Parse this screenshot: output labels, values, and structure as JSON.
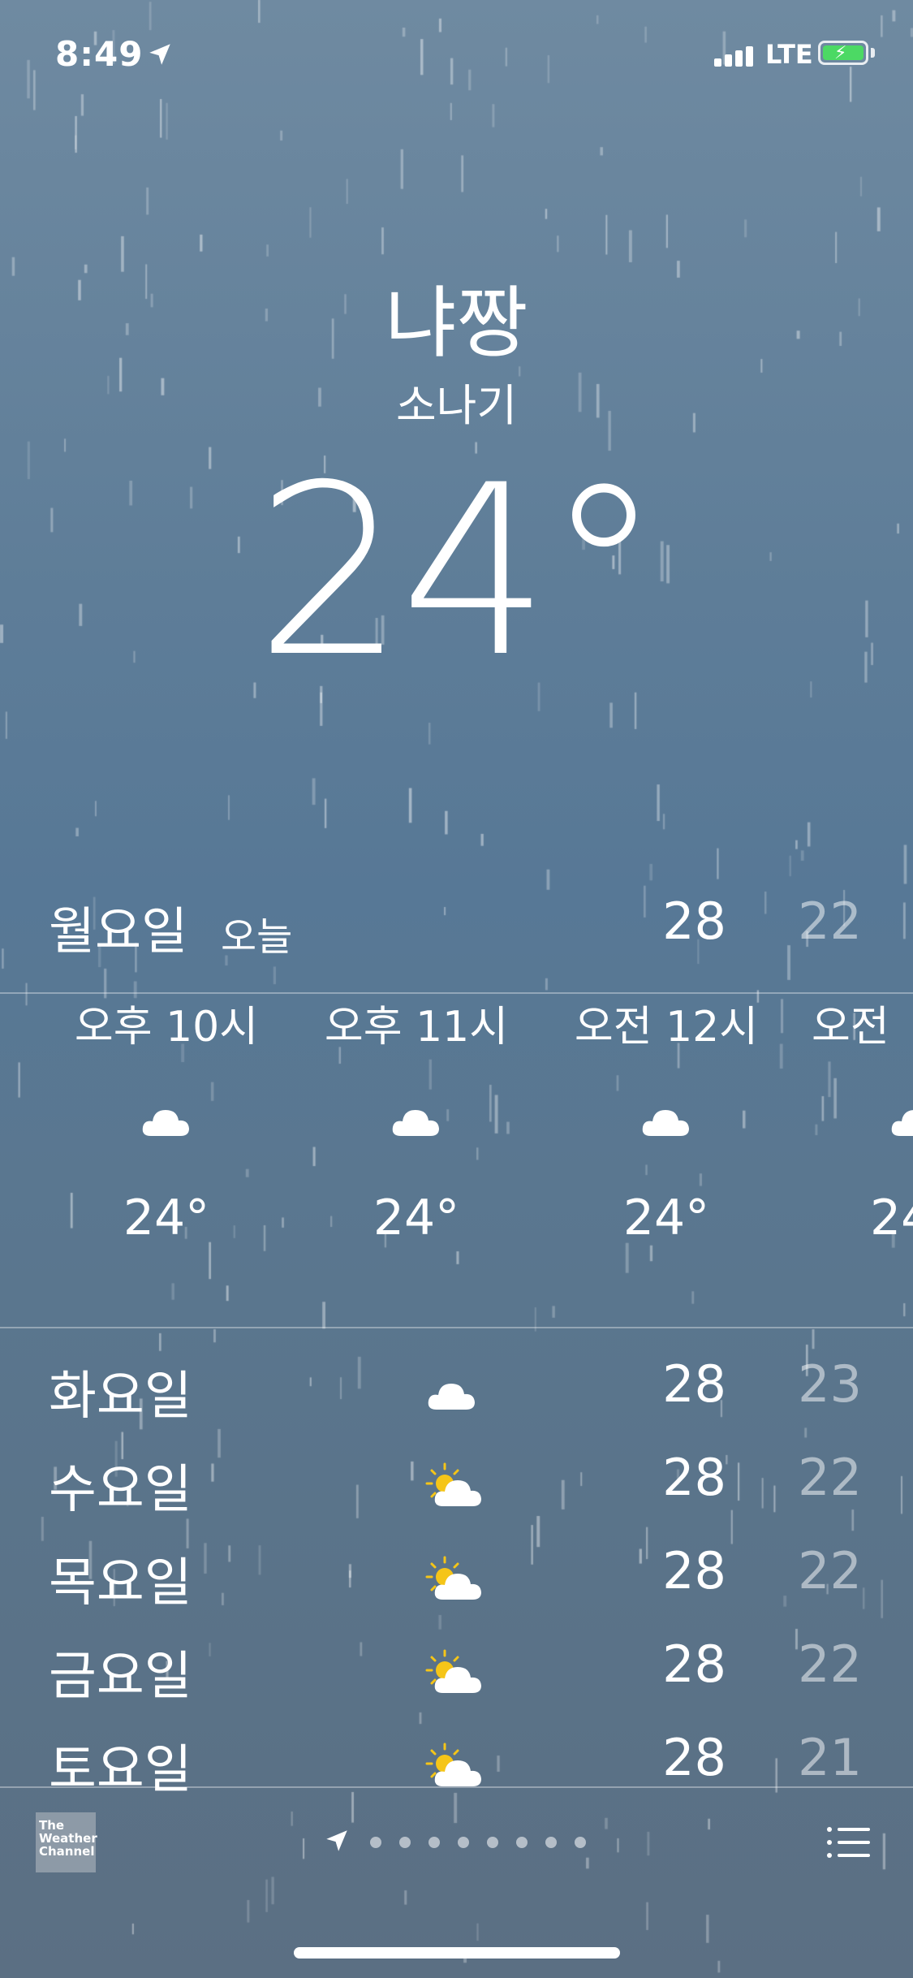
{
  "status_bar": {
    "time": "8:49",
    "network": "LTE"
  },
  "location": {
    "city": "냐짱",
    "condition": "소나기",
    "temperature": "24°"
  },
  "today": {
    "day": "월요일",
    "label": "오늘",
    "high": "28",
    "low": "22"
  },
  "hourly": [
    {
      "time": "오후 10시",
      "icon": "cloud-icon",
      "temp": "24°"
    },
    {
      "time": "오후 11시",
      "icon": "cloud-icon",
      "temp": "24°"
    },
    {
      "time": "오전 12시",
      "icon": "cloud-icon",
      "temp": "24°"
    },
    {
      "time": "오전",
      "icon": "cloud-icon",
      "temp": "24"
    }
  ],
  "daily": [
    {
      "day": "화요일",
      "icon": "cloud-icon",
      "high": "28",
      "low": "23"
    },
    {
      "day": "수요일",
      "icon": "partly-sunny-icon",
      "high": "28",
      "low": "22"
    },
    {
      "day": "목요일",
      "icon": "partly-sunny-icon",
      "high": "28",
      "low": "22"
    },
    {
      "day": "금요일",
      "icon": "partly-sunny-icon",
      "high": "28",
      "low": "22"
    },
    {
      "day": "토요일",
      "icon": "partly-sunny-icon",
      "high": "28",
      "low": "21"
    }
  ],
  "footer": {
    "logo_text": "The Weather Channel"
  },
  "colors": {
    "battery": "#4cd964",
    "sun": "#f5c518"
  }
}
